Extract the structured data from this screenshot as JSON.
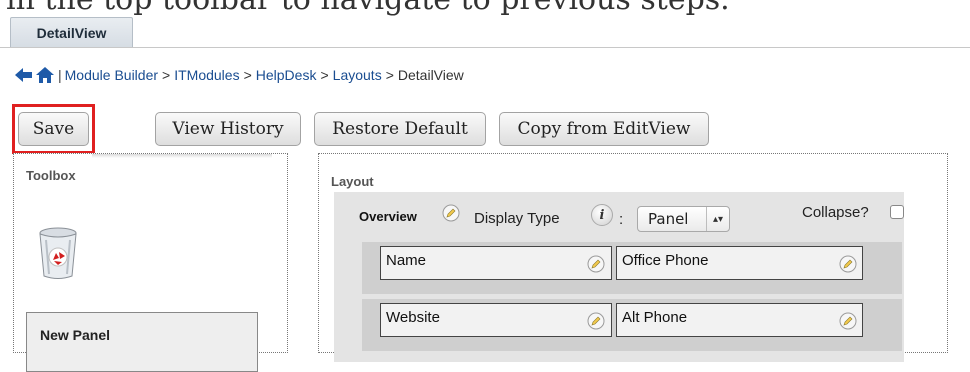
{
  "caption": "in the top toolbar to navigate to previous steps.",
  "tab": {
    "label": "DetailView"
  },
  "breadcrumb": {
    "separator": "|",
    "arrow": ">",
    "items": [
      "Module Builder",
      "ITModules",
      "HelpDesk",
      "Layouts"
    ],
    "current": "DetailView"
  },
  "buttons": {
    "save": "Save",
    "view_history": "View History",
    "restore_default": "Restore Default",
    "copy_from_editview": "Copy from EditView"
  },
  "toolbox": {
    "title": "Toolbox",
    "new_panel": "New Panel"
  },
  "layout": {
    "title": "Layout",
    "panel": {
      "name": "Overview",
      "display_type_label": "Display Type",
      "info_glyph": "i",
      "colon": ":",
      "display_type_value": "Panel",
      "collapse_label": "Collapse?",
      "rows": [
        {
          "left": "Name",
          "right": "Office Phone"
        },
        {
          "left": "Website",
          "right": "Alt Phone"
        }
      ]
    }
  },
  "colors": {
    "highlight": "#e02020",
    "link": "#1a4d91",
    "panel_bg": "#e4e4e4",
    "row_bg": "#cfcfcf"
  }
}
